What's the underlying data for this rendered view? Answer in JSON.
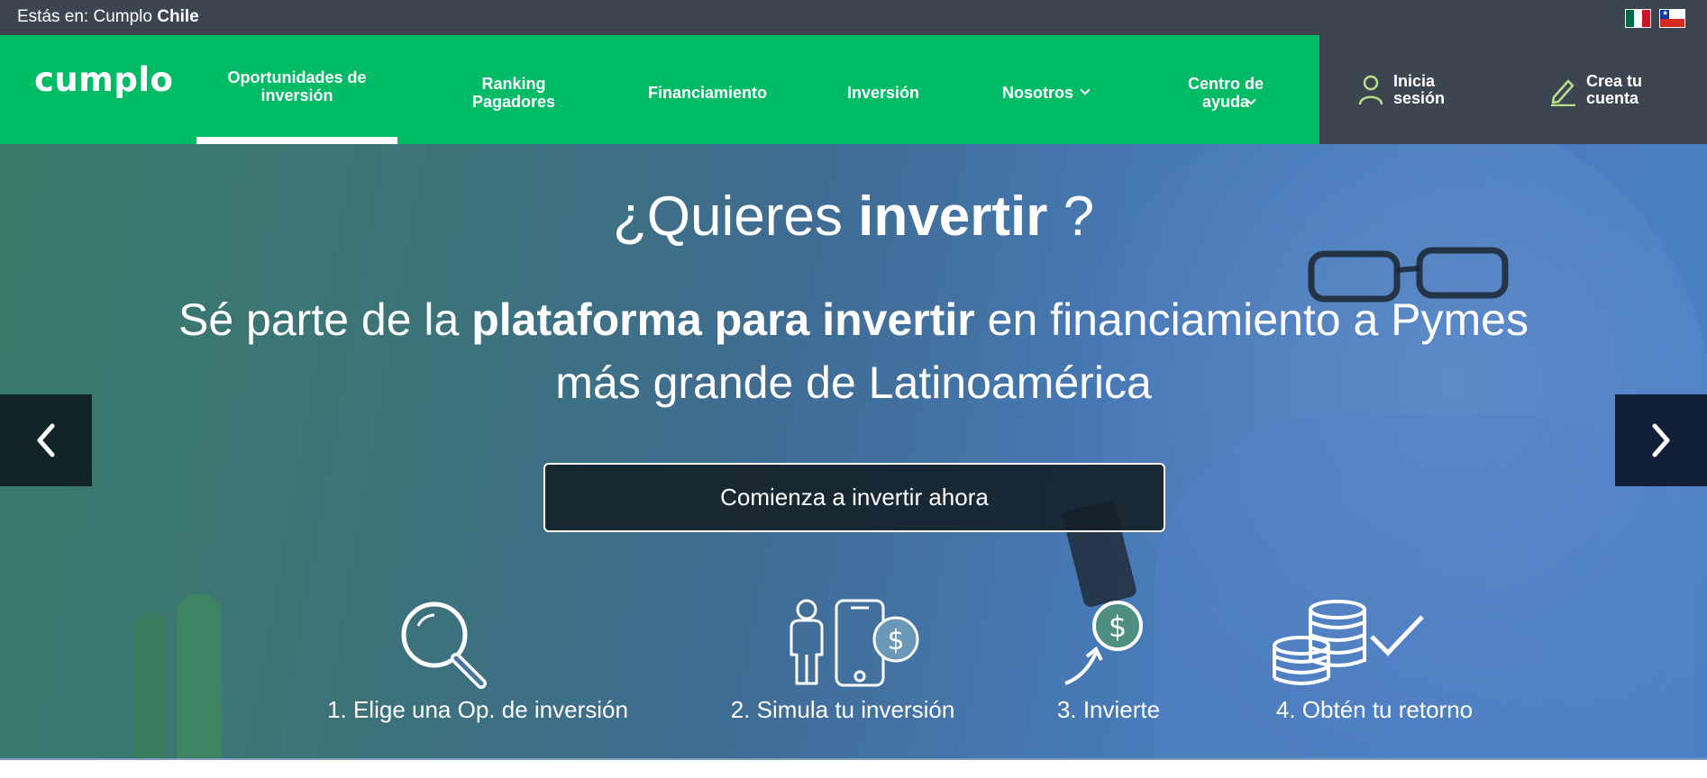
{
  "country_bar": {
    "prefix": "Estás en: Cumplo",
    "country": "Chile"
  },
  "logo": "cumplo",
  "nav": {
    "items": [
      {
        "label": "Oportunidades de inversión",
        "active": true
      },
      {
        "label": "Ranking Pagadores"
      },
      {
        "label": "Financiamiento"
      },
      {
        "label": "Inversión"
      },
      {
        "label": "Nosotros",
        "dropdown": true
      },
      {
        "label": "Centro de ayuda",
        "dropdown": true
      }
    ]
  },
  "account": {
    "login": "Inicia sesión",
    "signup": "Crea tu cuenta"
  },
  "hero": {
    "title_prefix": "¿Quieres",
    "title_bold": "invertir",
    "title_suffix": "?",
    "sub_prefix": "Sé parte de la",
    "sub_bold": "plataforma para invertir",
    "sub_suffix": "en financiamiento a Pymes más grande de Latinoamérica",
    "cta": "Comienza a invertir ahora"
  },
  "steps": [
    {
      "label": "1. Elige una Op. de inversión",
      "icon": "magnifier-icon"
    },
    {
      "label": "2. Simula tu inversión",
      "icon": "person-phone-dollar-icon"
    },
    {
      "label": "3. Invierte",
      "icon": "dollar-arrow-icon"
    },
    {
      "label": "4. Obtén tu retorno",
      "icon": "coins-check-icon"
    }
  ],
  "colors": {
    "brand_green": "#00bb66",
    "dark_bar": "#3c4550"
  }
}
